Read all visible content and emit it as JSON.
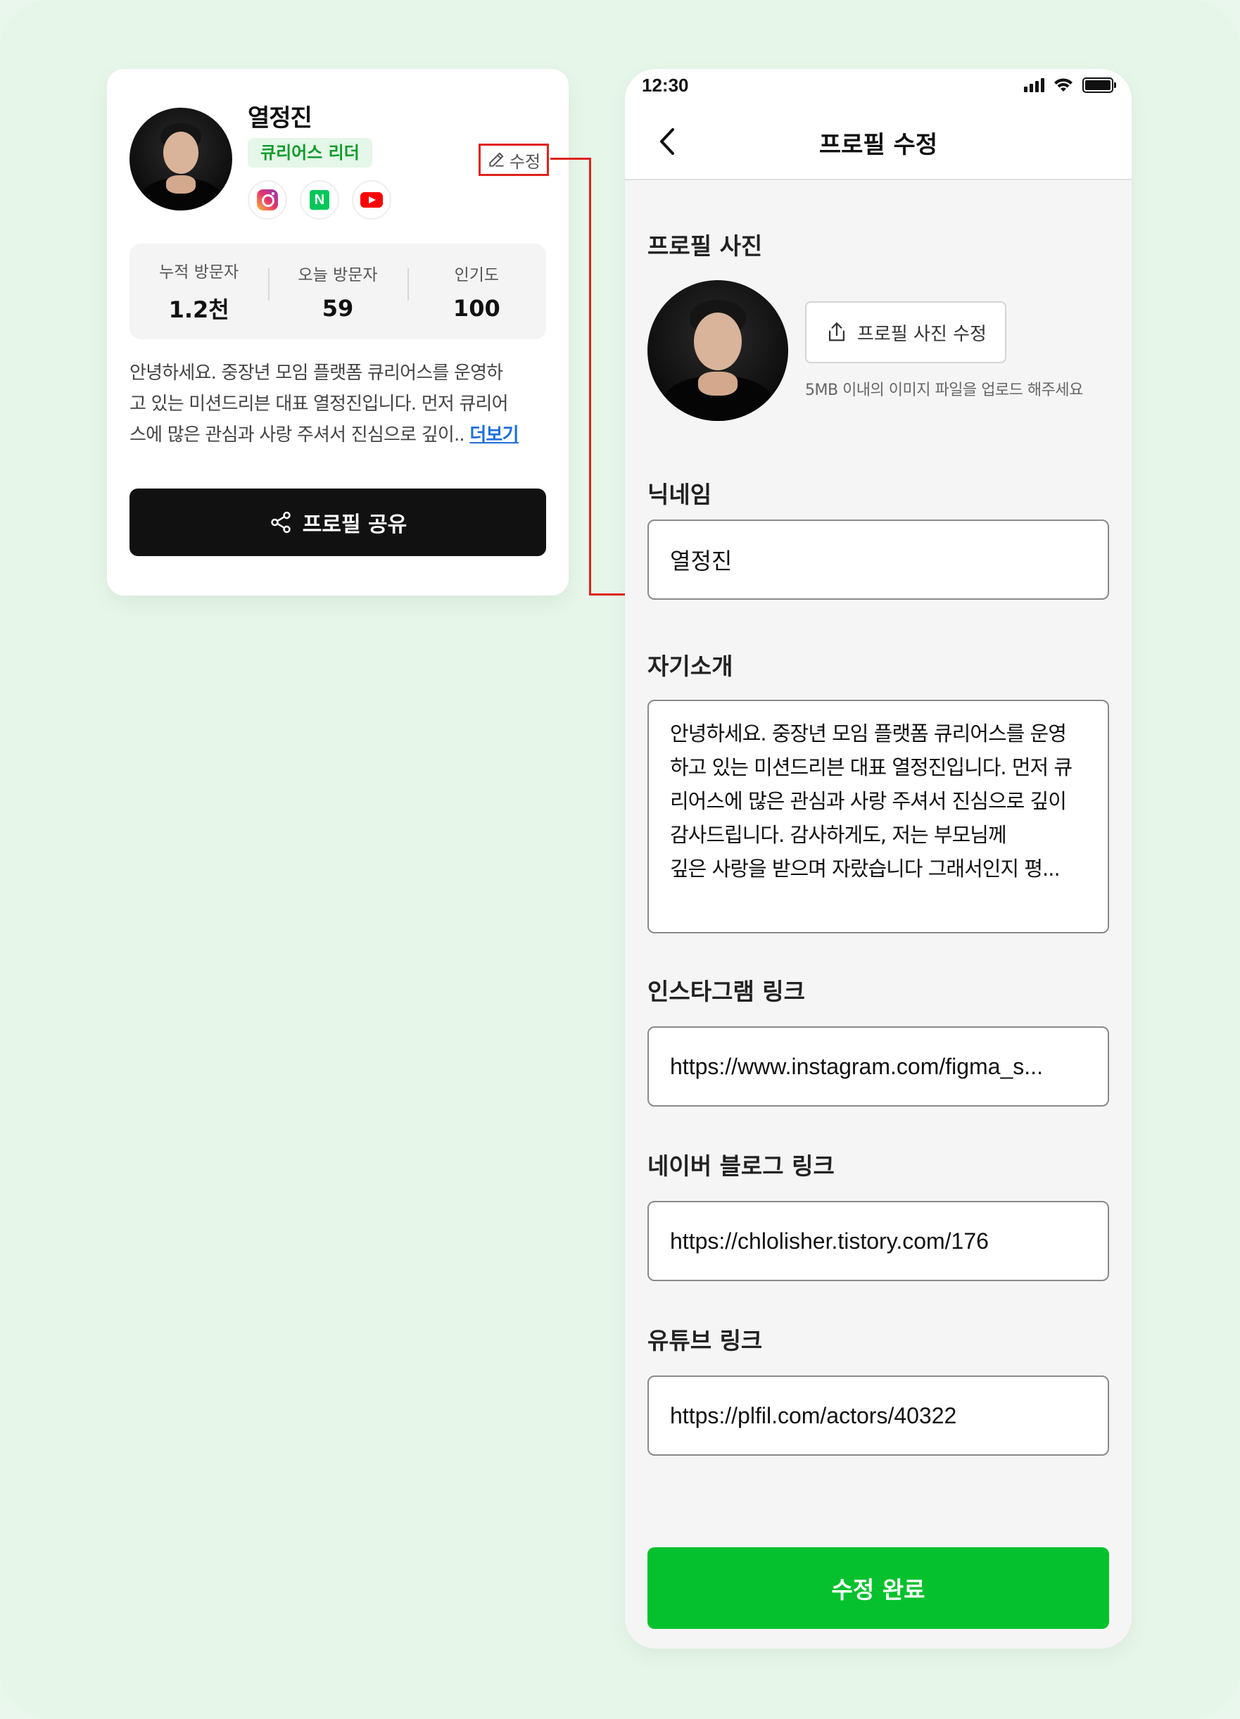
{
  "card": {
    "name": "열정진",
    "role": "큐리어스 리더",
    "edit_label": "수정",
    "socials": [
      "instagram-icon",
      "naver-icon",
      "youtube-icon"
    ],
    "naver_letter": "N",
    "stats": [
      {
        "label": "누적 방문자",
        "value": "1.2천"
      },
      {
        "label": "오늘 방문자",
        "value": "59"
      },
      {
        "label": "인기도",
        "value": "100"
      }
    ],
    "bio_lines": [
      "안녕하세요. 중장년 모임 플랫폼 큐리어스를 운영하",
      "고 있는 미션드리븐 대표 열정진입니다. 먼저 큐리어",
      "스에 많은 관심과 사랑 주셔서 진심으로 깊이.."
    ],
    "more_label": "더보기",
    "share_label": "프로필 공유"
  },
  "phone": {
    "time": "12:30",
    "title": "프로필 수정",
    "photo_section_label": "프로필 사진",
    "photo_button_label": "프로필 사진 수정",
    "photo_hint": "5MB 이내의 이미지 파일을 업로드 해주세요",
    "nickname_label": "닉네임",
    "nickname_value": "열정진",
    "intro_label": "자기소개",
    "intro_lines": [
      "안녕하세요. 중장년 모임 플랫폼 큐리어스를 운영",
      "하고 있는 미션드리븐 대표 열정진입니다. 먼저 큐",
      "리어스에 많은 관심과 사랑 주셔서 진심으로 깊이",
      "감사드립니다. 감사하게도, 저는 부모님께",
      "깊은 사랑을 받으며 자랐습니다 그래서인지 평..."
    ],
    "instagram_label": "인스타그램 링크",
    "instagram_value": "https://www.instagram.com/figma_s...",
    "naver_label": "네이버 블로그 링크",
    "naver_value": "https://chlolisher.tistory.com/176",
    "youtube_label": "유튜브 링크",
    "youtube_value": "https://plfil.com/actors/40322",
    "submit_label": "수정 완료"
  },
  "colors": {
    "background": "#e6f6e9",
    "accent_green": "#06c12e",
    "highlight_red": "#e0231d",
    "link_blue": "#1e6fd9"
  }
}
